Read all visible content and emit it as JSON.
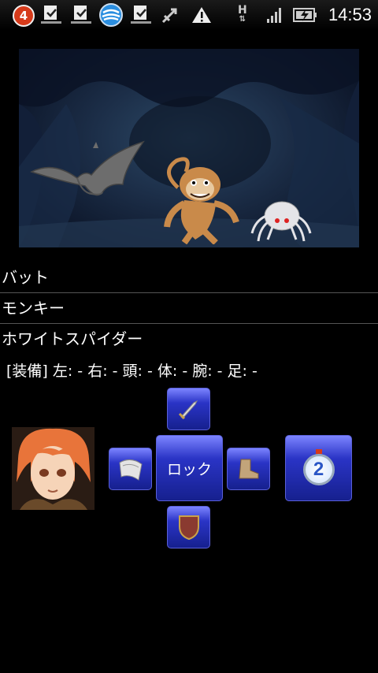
{
  "status_bar": {
    "notification_count": "4",
    "time": "14:53",
    "network_type": "H"
  },
  "enemies": [
    {
      "name": "バット",
      "sprite": "bat"
    },
    {
      "name": "モンキー",
      "sprite": "monkey"
    },
    {
      "name": "ホワイトスパイダー",
      "sprite": "white-spider"
    }
  ],
  "equipment_line": "[装備]  左: - 右: - 頭: - 体: - 腕: - 足: -",
  "controls": {
    "center_label": "ロック",
    "up_icon": "sword-icon",
    "left_icon": "arm-guard-icon",
    "right_icon": "boot-icon",
    "down_icon": "shield-icon",
    "turn_badge": "2"
  },
  "colors": {
    "button_top": "#7c84ff",
    "button_bottom": "#16208e",
    "background": "#000000"
  }
}
